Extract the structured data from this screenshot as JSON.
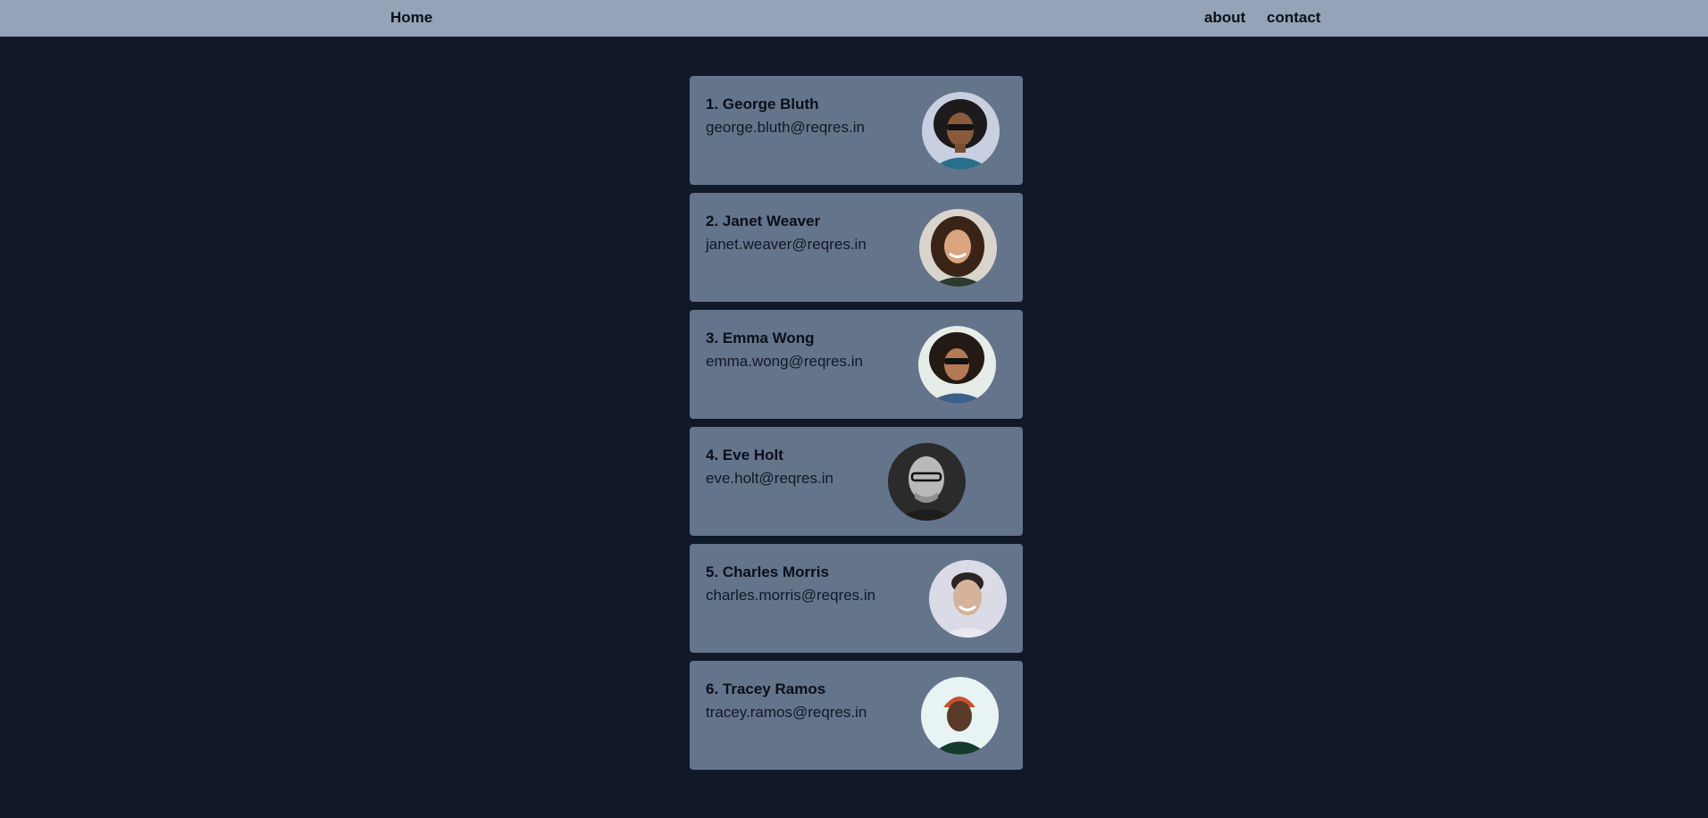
{
  "nav": {
    "home_label": "Home",
    "about_label": "about",
    "contact_label": "contact"
  },
  "users": [
    {
      "name": "1. George Bluth",
      "email": "george.bluth@reqres.in",
      "avatar": "person-with-curly-hair-and-sunglasses"
    },
    {
      "name": "2. Janet Weaver",
      "email": "janet.weaver@reqres.in",
      "avatar": "smiling-woman-with-wavy-hair"
    },
    {
      "name": "3. Emma Wong",
      "email": "emma.wong@reqres.in",
      "avatar": "woman-with-curly-hair-and-sunglasses"
    },
    {
      "name": "4. Eve Holt",
      "email": "eve.holt@reqres.in",
      "avatar": "bald-man-with-glasses"
    },
    {
      "name": "5. Charles Morris",
      "email": "charles.morris@reqres.in",
      "avatar": "smiling-man-with-dark-hair"
    },
    {
      "name": "6. Tracey Ramos",
      "email": "tracey.ramos@reqres.in",
      "avatar": "man-in-orange-beanie"
    }
  ],
  "colors": {
    "background": "#111827",
    "navbar": "#94a3b8",
    "card": "#64748b"
  }
}
